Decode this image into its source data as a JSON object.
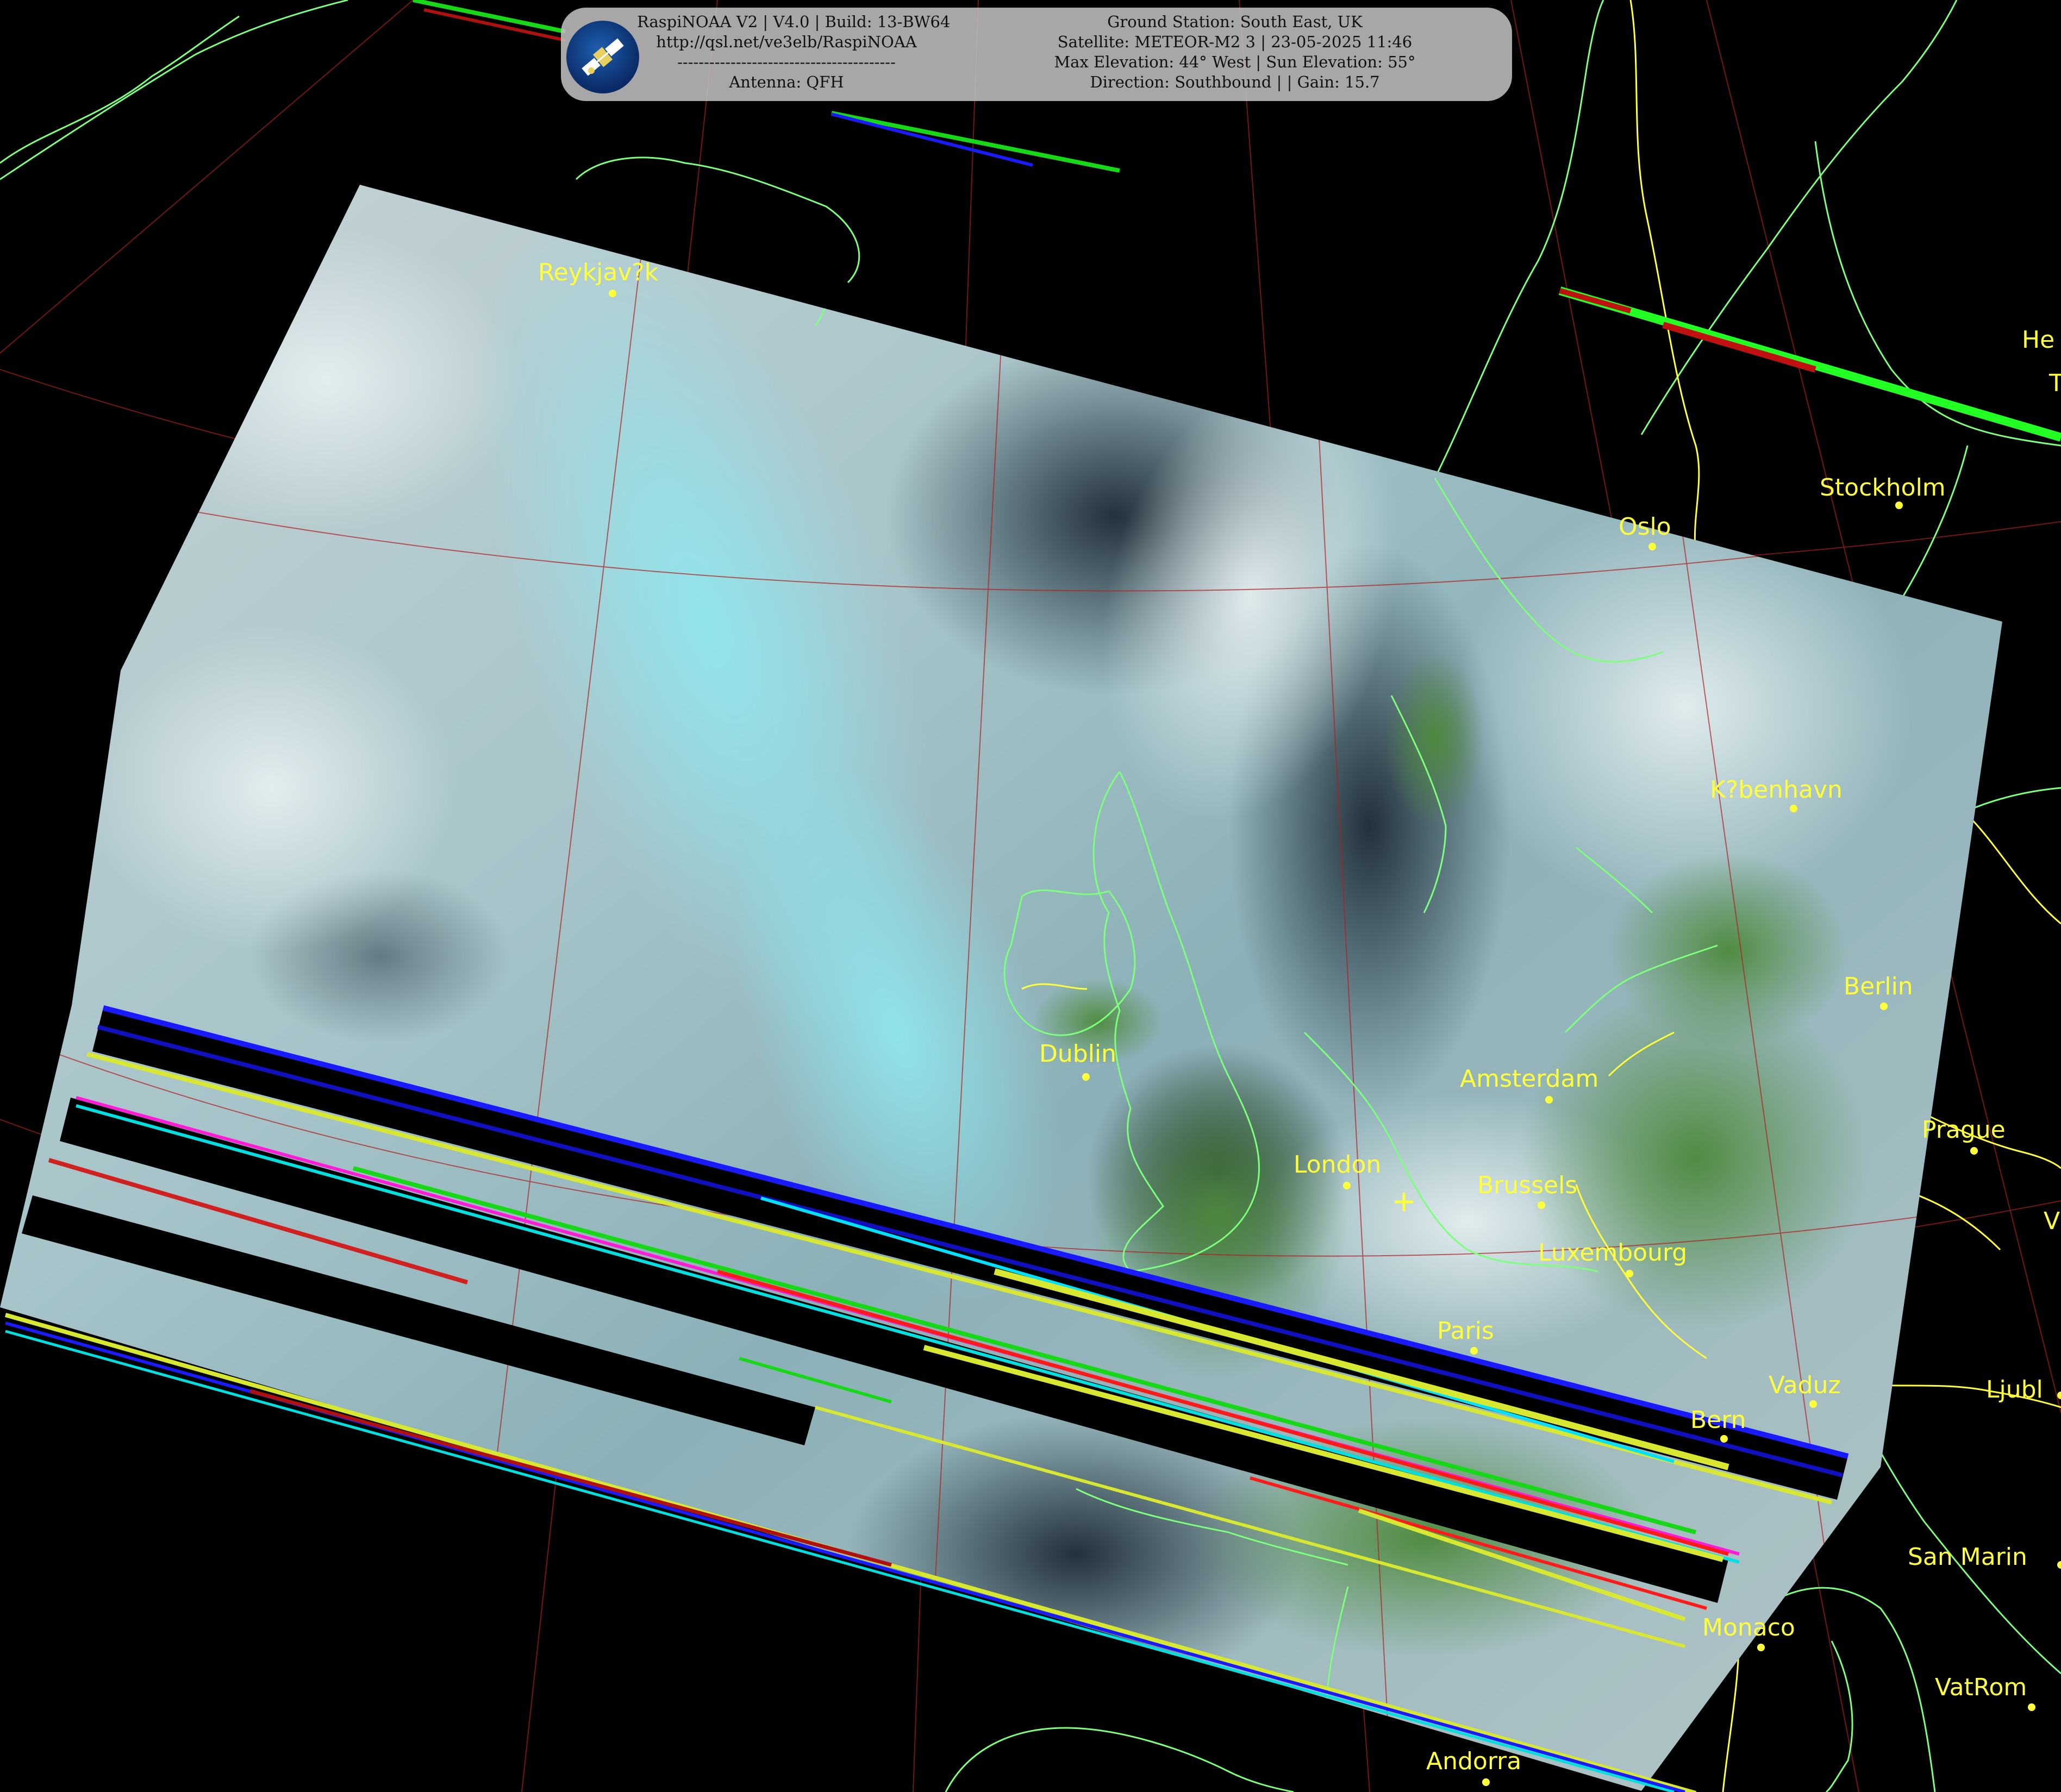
{
  "header": {
    "software_line": "RaspiNOAA V2 | V4.0 | Build: 13-BW64",
    "url": "http://qsl.net/ve3elb/RaspiNOAA",
    "separator": "-----------------------------------------",
    "antenna": "Antenna: QFH",
    "ground_station": "Ground Station: South East, UK",
    "satellite": "Satellite: METEOR-M2 3 | 23-05-2025 11:46",
    "elevation": "Max Elevation: 44° West | Sun Elevation: 55°",
    "direction": "Direction: Southbound | | Gain: 15.7"
  },
  "logo_icon": "satellite-icon",
  "cities": [
    {
      "name": "Reykjav?k"
    },
    {
      "name": "Stockholm"
    },
    {
      "name": "Oslo"
    },
    {
      "name": "K?benhavn"
    },
    {
      "name": "Berlin"
    },
    {
      "name": "Dublin"
    },
    {
      "name": "Amsterdam"
    },
    {
      "name": "London"
    },
    {
      "name": "Brussels"
    },
    {
      "name": "Prague"
    },
    {
      "name": "Luxembourg"
    },
    {
      "name": "Paris"
    },
    {
      "name": "Vaduz"
    },
    {
      "name": "Bern"
    },
    {
      "name": "Ljubl"
    },
    {
      "name": "San Marin"
    },
    {
      "name": "Monaco"
    },
    {
      "name": "VatRom"
    },
    {
      "name": "Andorra"
    },
    {
      "name": "He"
    },
    {
      "name": "T"
    },
    {
      "name": "V"
    }
  ],
  "colors": {
    "city_label": "#ffff3a",
    "coastline": "#7dff7d",
    "border": "#ffff3a",
    "graticule": "#b02020",
    "cloud": "#cde6ea",
    "haze": "#8ee8f0"
  }
}
